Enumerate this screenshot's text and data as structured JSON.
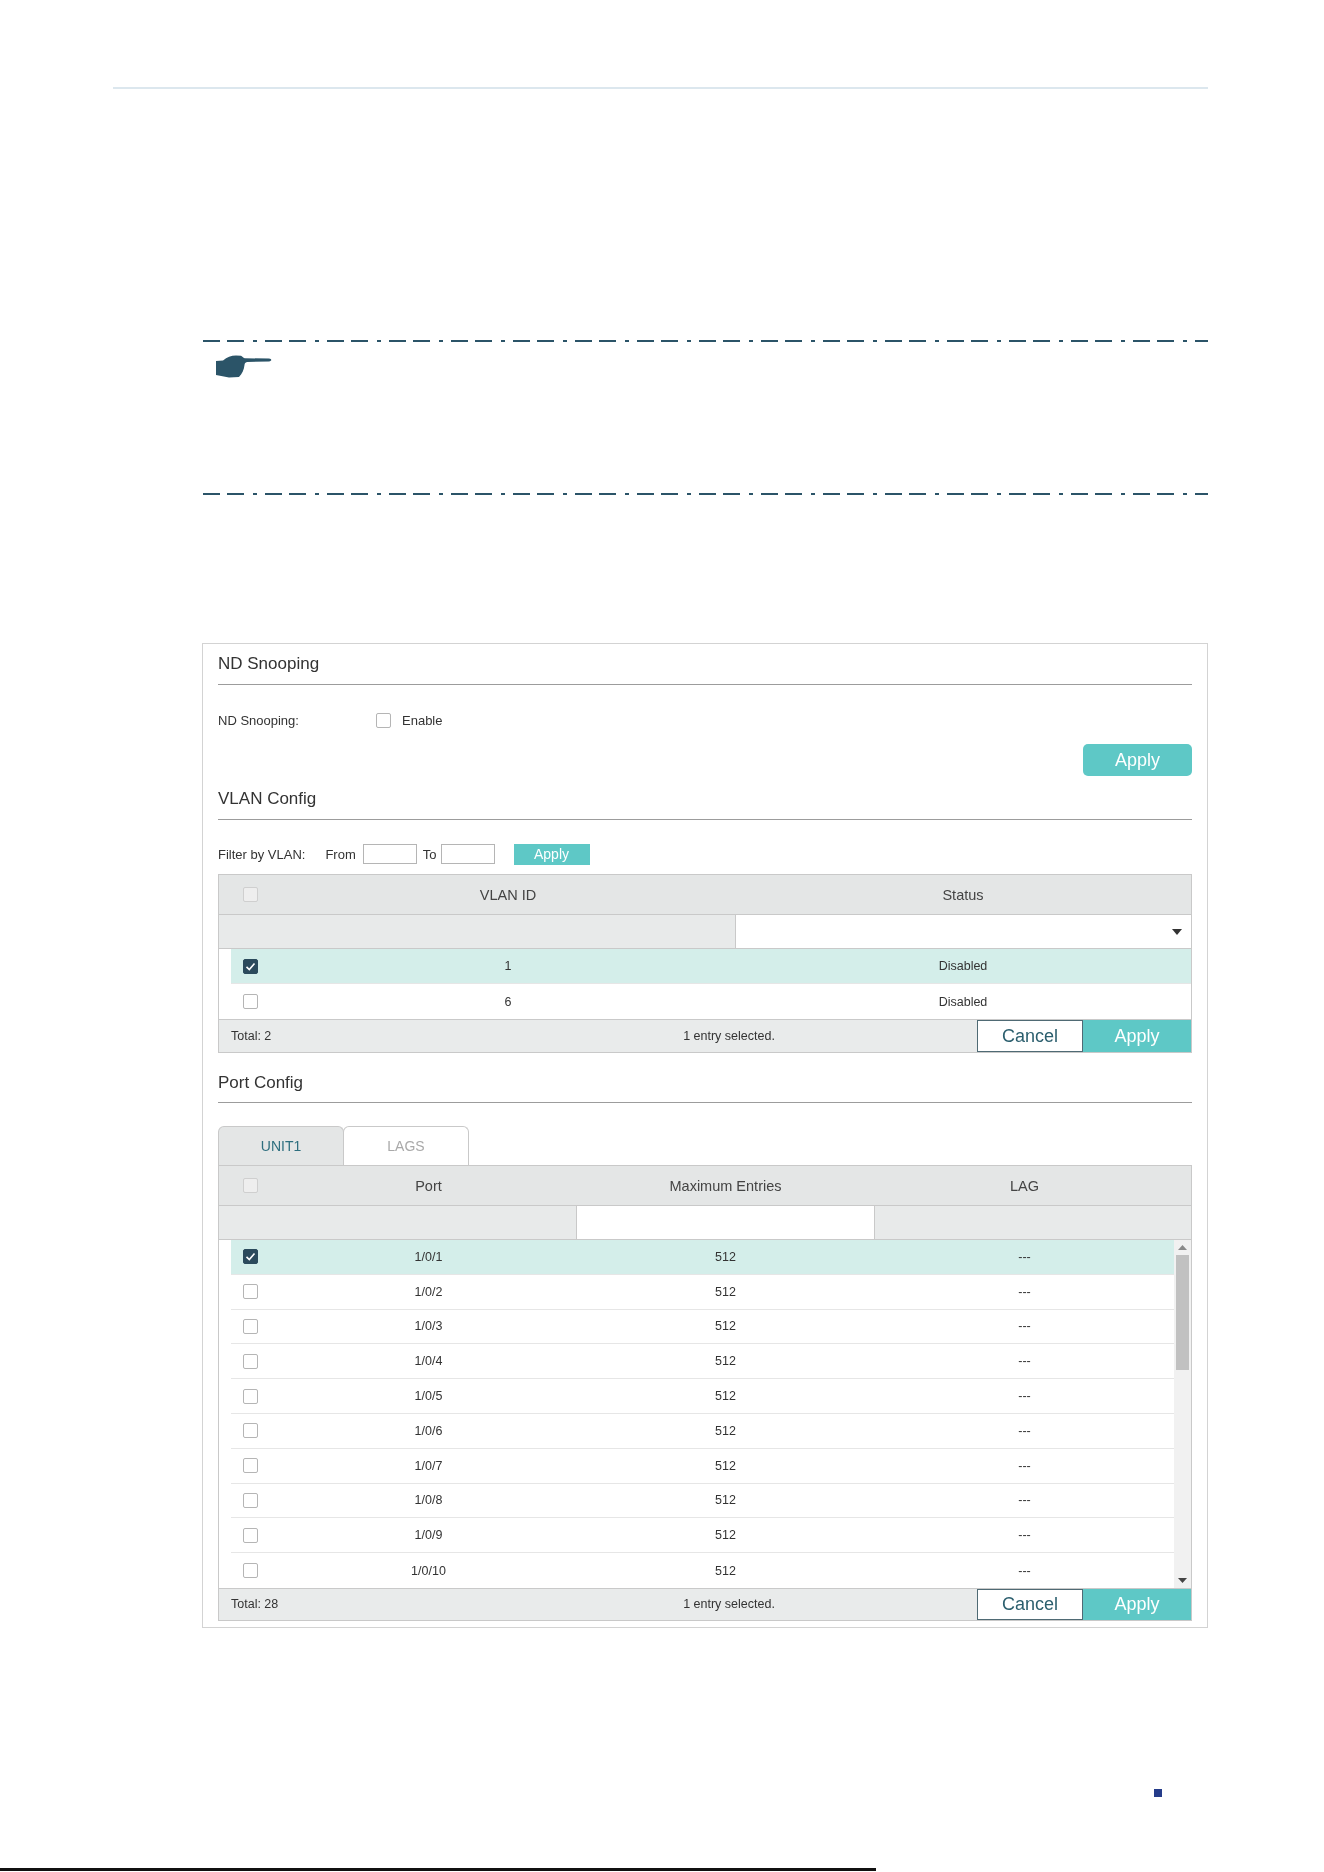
{
  "nd_snooping": {
    "title": "ND Snooping",
    "field_label": "ND Snooping:",
    "option": {
      "label": "Enable",
      "checked": false
    },
    "apply_button": "Apply"
  },
  "vlan_config": {
    "title": "VLAN Config",
    "filter": {
      "label": "Filter by VLAN:",
      "from_label": "From",
      "to_label": "To",
      "button": "Apply"
    },
    "table": {
      "select_all_checked": false,
      "columns": [
        {
          "label": "VLAN ID",
          "kind": "locked"
        },
        {
          "label": "Status",
          "kind": "select"
        }
      ],
      "rows": [
        {
          "cells": [
            "1",
            "Disabled"
          ],
          "selected": true
        },
        {
          "cells": [
            "6",
            "Disabled"
          ],
          "selected": false
        }
      ],
      "total": "Total: 2",
      "selection_info": "1 entry selected.",
      "buttons": [
        {
          "label": "Cancel",
          "kind": "secondary"
        },
        {
          "label": "Apply",
          "kind": "primary"
        }
      ]
    }
  },
  "port_config": {
    "title": "Port Config",
    "tabs": [
      {
        "label": "UNIT1",
        "selected": true
      },
      {
        "label": "LAGS",
        "selected": false
      }
    ],
    "table": {
      "select_all_checked": false,
      "columns": [
        {
          "label": "Port",
          "kind": "locked"
        },
        {
          "label": "Maximum Entries",
          "kind": "input"
        },
        {
          "label": "LAG",
          "kind": "locked"
        }
      ],
      "rows": [
        {
          "cells": [
            "1/0/1",
            "512",
            "---"
          ],
          "selected": true
        },
        {
          "cells": [
            "1/0/2",
            "512",
            "---"
          ],
          "selected": false
        },
        {
          "cells": [
            "1/0/3",
            "512",
            "---"
          ],
          "selected": false
        },
        {
          "cells": [
            "1/0/4",
            "512",
            "---"
          ],
          "selected": false
        },
        {
          "cells": [
            "1/0/5",
            "512",
            "---"
          ],
          "selected": false
        },
        {
          "cells": [
            "1/0/6",
            "512",
            "---"
          ],
          "selected": false
        },
        {
          "cells": [
            "1/0/7",
            "512",
            "---"
          ],
          "selected": false
        },
        {
          "cells": [
            "1/0/8",
            "512",
            "---"
          ],
          "selected": false
        },
        {
          "cells": [
            "1/0/9",
            "512",
            "---"
          ],
          "selected": false
        },
        {
          "cells": [
            "1/0/10",
            "512",
            "---"
          ],
          "selected": false
        }
      ],
      "total": "Total: 28",
      "selection_info": "1 entry selected.",
      "buttons": [
        {
          "label": "Cancel",
          "kind": "secondary"
        },
        {
          "label": "Apply",
          "kind": "primary"
        }
      ]
    }
  }
}
